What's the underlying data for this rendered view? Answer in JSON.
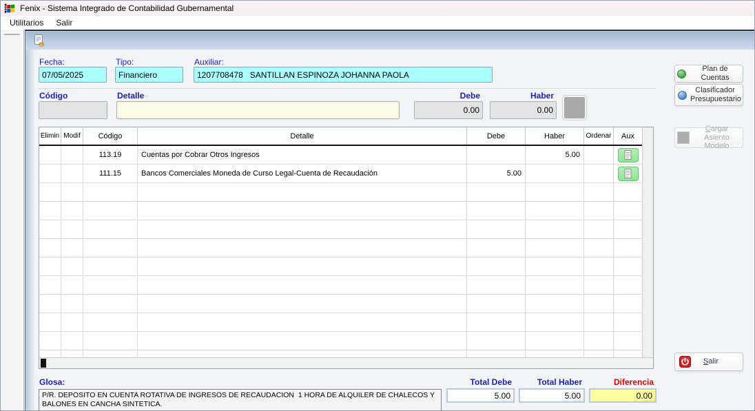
{
  "window": {
    "title": "Fenix - Sistema Integrado de Contabilidad Gubernamental",
    "app_icon": "windows-flag-icon"
  },
  "menu": {
    "items": [
      "Utilitarios",
      "Salir"
    ]
  },
  "toolbar": {
    "new_entry_icon": "document-coins-icon"
  },
  "form": {
    "fecha": {
      "label": "Fecha:",
      "value": "07/05/2025"
    },
    "tipo": {
      "label": "Tipo:",
      "value": "Financiero"
    },
    "auxiliar": {
      "label": "Auxiliar:",
      "value": "1207708478   SANTILLAN ESPINOZA JOHANNA PAOLA"
    }
  },
  "entry": {
    "codigo": {
      "label": "Código",
      "value": ""
    },
    "detalle": {
      "label": "Detalle",
      "value": ""
    },
    "debe": {
      "label": "Debe",
      "value": "0.00"
    },
    "haber": {
      "label": "Haber",
      "value": "0.00"
    }
  },
  "table": {
    "headers": [
      "Elimin",
      "Modif",
      "Código",
      "Detalle",
      "Debe",
      "Haber",
      "Ordenar",
      "Aux"
    ],
    "rows": [
      {
        "codigo": "113.19",
        "detalle": "Cuentas por Cobrar Otros Ingresos",
        "debe": "",
        "haber": "5.00",
        "aux_icon": "note-icon"
      },
      {
        "codigo": "111.15",
        "detalle": "Bancos Comerciales Moneda de Curso Legal-Cuenta de Recaudación",
        "debe": "5.00",
        "haber": "",
        "aux_icon": "note-icon"
      }
    ],
    "empty_row_count": 10
  },
  "side_panel": {
    "plan_de_cuentas": "Plan de Cuentas",
    "clasificador_presupuestario": "Clasificador Presupuestario",
    "cargar_asiento_modelo": "Cargar Asiento Modelo",
    "salir": "Salir"
  },
  "footer": {
    "glosa": {
      "label": "Glosa:",
      "value": "P/R. DEPOSITO EN CUENTA ROTATIVA DE INGRESOS DE RECAUDACION  1 HORA DE ALQUILER DE CHALECOS Y BALONES EN CANCHA SINTETICA."
    },
    "total_debe": {
      "label": "Total Debe",
      "value": "5.00"
    },
    "total_haber": {
      "label": "Total Haber",
      "value": "5.00"
    },
    "diferencia": {
      "label": "Diferencia",
      "value": "0.00"
    }
  },
  "colors": {
    "field_cyan": "#aaffff",
    "field_ivory": "#fbfae6",
    "diferencia_yellow": "#ffffa0",
    "label_navy": "#1d1db4",
    "diferencia_red": "#e00000",
    "aux_green": "#9ceba0",
    "toolbar_gradient_top": "#a2b7d4",
    "toolbar_gradient_bottom": "#cedbeb",
    "titlebar_pink": "#f7f0f3"
  }
}
